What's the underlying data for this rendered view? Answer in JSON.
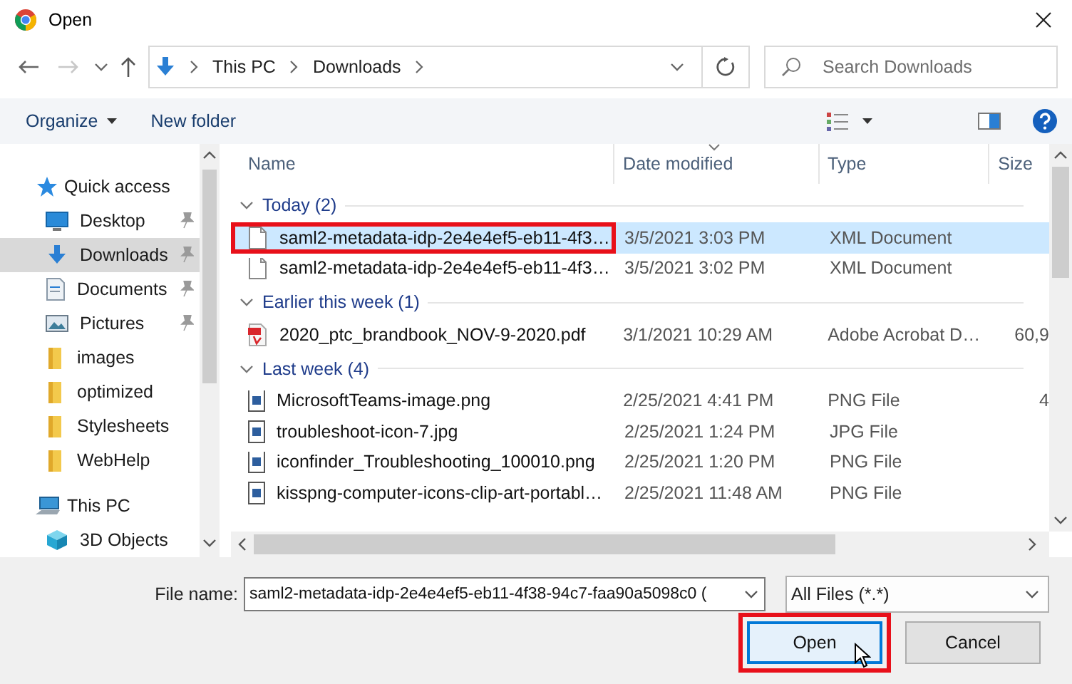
{
  "window": {
    "title": "Open"
  },
  "address": {
    "crumbs": [
      "This PC",
      "Downloads"
    ]
  },
  "search": {
    "placeholder": "Search Downloads"
  },
  "toolbar": {
    "organize": "Organize",
    "new_folder": "New folder"
  },
  "nav_pane": [
    {
      "label": "Quick access",
      "pinned": false,
      "selected": false,
      "kind": "header"
    },
    {
      "label": "Desktop",
      "pinned": true,
      "selected": false,
      "kind": "item"
    },
    {
      "label": "Downloads",
      "pinned": true,
      "selected": true,
      "kind": "item"
    },
    {
      "label": "Documents",
      "pinned": true,
      "selected": false,
      "kind": "item"
    },
    {
      "label": "Pictures",
      "pinned": true,
      "selected": false,
      "kind": "item"
    },
    {
      "label": "images",
      "pinned": false,
      "selected": false,
      "kind": "item"
    },
    {
      "label": "optimized",
      "pinned": false,
      "selected": false,
      "kind": "item"
    },
    {
      "label": "Stylesheets",
      "pinned": false,
      "selected": false,
      "kind": "item"
    },
    {
      "label": "WebHelp",
      "pinned": false,
      "selected": false,
      "kind": "item"
    },
    {
      "label": "This PC",
      "pinned": false,
      "selected": false,
      "kind": "header"
    },
    {
      "label": "3D Objects",
      "pinned": false,
      "selected": false,
      "kind": "item"
    }
  ],
  "columns": [
    {
      "label": "Name",
      "sorted": false
    },
    {
      "label": "Date modified",
      "sorted": true
    },
    {
      "label": "Type",
      "sorted": false
    },
    {
      "label": "Size",
      "sorted": false
    }
  ],
  "groups": [
    {
      "label": "Today (2)",
      "expanded": true,
      "rows": [
        {
          "name": "saml2-metadata-idp-2e4e4ef5-eb11-4f3…",
          "date": "3/5/2021 3:03 PM",
          "type": "XML Document",
          "kind": "document",
          "selected": true,
          "highlighted": true
        },
        {
          "name": "saml2-metadata-idp-2e4e4ef5-eb11-4f3…",
          "date": "3/5/2021 3:02 PM",
          "type": "XML Document",
          "kind": "document",
          "selected": false,
          "highlighted": false
        }
      ]
    },
    {
      "label": "Earlier this week (1)",
      "expanded": true,
      "rows": [
        {
          "name": "2020_ptc_brandbook_NOV-9-2020.pdf",
          "date": "3/1/2021 10:29 AM",
          "type": "Adobe Acrobat D…",
          "size": "60,9",
          "kind": "pdf",
          "selected": false,
          "highlighted": false
        }
      ]
    },
    {
      "label": "Last week (4)",
      "expanded": true,
      "rows": [
        {
          "name": "MicrosoftTeams-image.png",
          "date": "2/25/2021 4:41 PM",
          "type": "PNG File",
          "size": "4",
          "kind": "image",
          "selected": false,
          "highlighted": false
        },
        {
          "name": "troubleshoot-icon-7.jpg",
          "date": "2/25/2021 1:24 PM",
          "type": "JPG File",
          "kind": "image",
          "selected": false,
          "highlighted": false
        },
        {
          "name": "iconfinder_Troubleshooting_100010.png",
          "date": "2/25/2021 1:20 PM",
          "type": "PNG File",
          "kind": "image",
          "selected": false,
          "highlighted": false
        },
        {
          "name": "kisspng-computer-icons-clip-art-portabl…",
          "date": "2/25/2021 11:48 AM",
          "type": "PNG File",
          "kind": "image",
          "selected": false,
          "highlighted": false
        }
      ]
    }
  ],
  "file_name": {
    "label": "File name:",
    "value": "saml2-metadata-idp-2e4e4ef5-eb11-4f38-94c7-faa90a5098c0 ("
  },
  "file_type": {
    "value": "All Files (*.*)"
  },
  "buttons": [
    {
      "label": "Open",
      "kind": "default",
      "highlighted": true
    },
    {
      "label": "Cancel",
      "kind": "normal",
      "highlighted": false
    }
  ]
}
